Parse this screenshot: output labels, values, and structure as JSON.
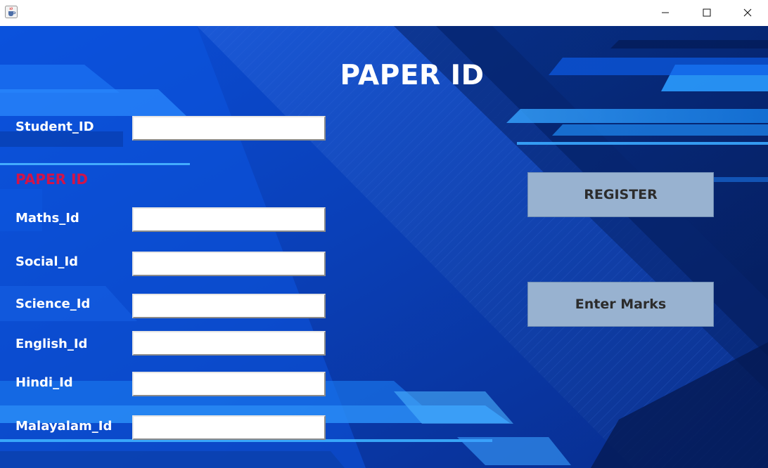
{
  "window": {
    "title": "",
    "app_icon": "java-cup-icon",
    "controls": [
      "minimize-icon",
      "maximize-icon",
      "close-icon"
    ]
  },
  "page": {
    "title": "PAPER ID"
  },
  "form": {
    "student_id_label": "Student_ID",
    "student_id_value": "",
    "section_label": "PAPER ID",
    "fields": [
      {
        "label": "Maths_Id",
        "value": ""
      },
      {
        "label": "Social_Id",
        "value": ""
      },
      {
        "label": "Science_Id",
        "value": ""
      },
      {
        "label": "English_Id",
        "value": ""
      },
      {
        "label": "Hindi_Id",
        "value": ""
      },
      {
        "label": "Malayalam_Id",
        "value": ""
      }
    ]
  },
  "buttons": {
    "register": "REGISTER",
    "enter_marks": "Enter Marks"
  },
  "colors": {
    "background_dark": "#0a2a8a",
    "background_light": "#1d7cf0",
    "section_label": "#d0144a",
    "button_fill": "#98b2d0",
    "label_text": "#ffffff"
  }
}
